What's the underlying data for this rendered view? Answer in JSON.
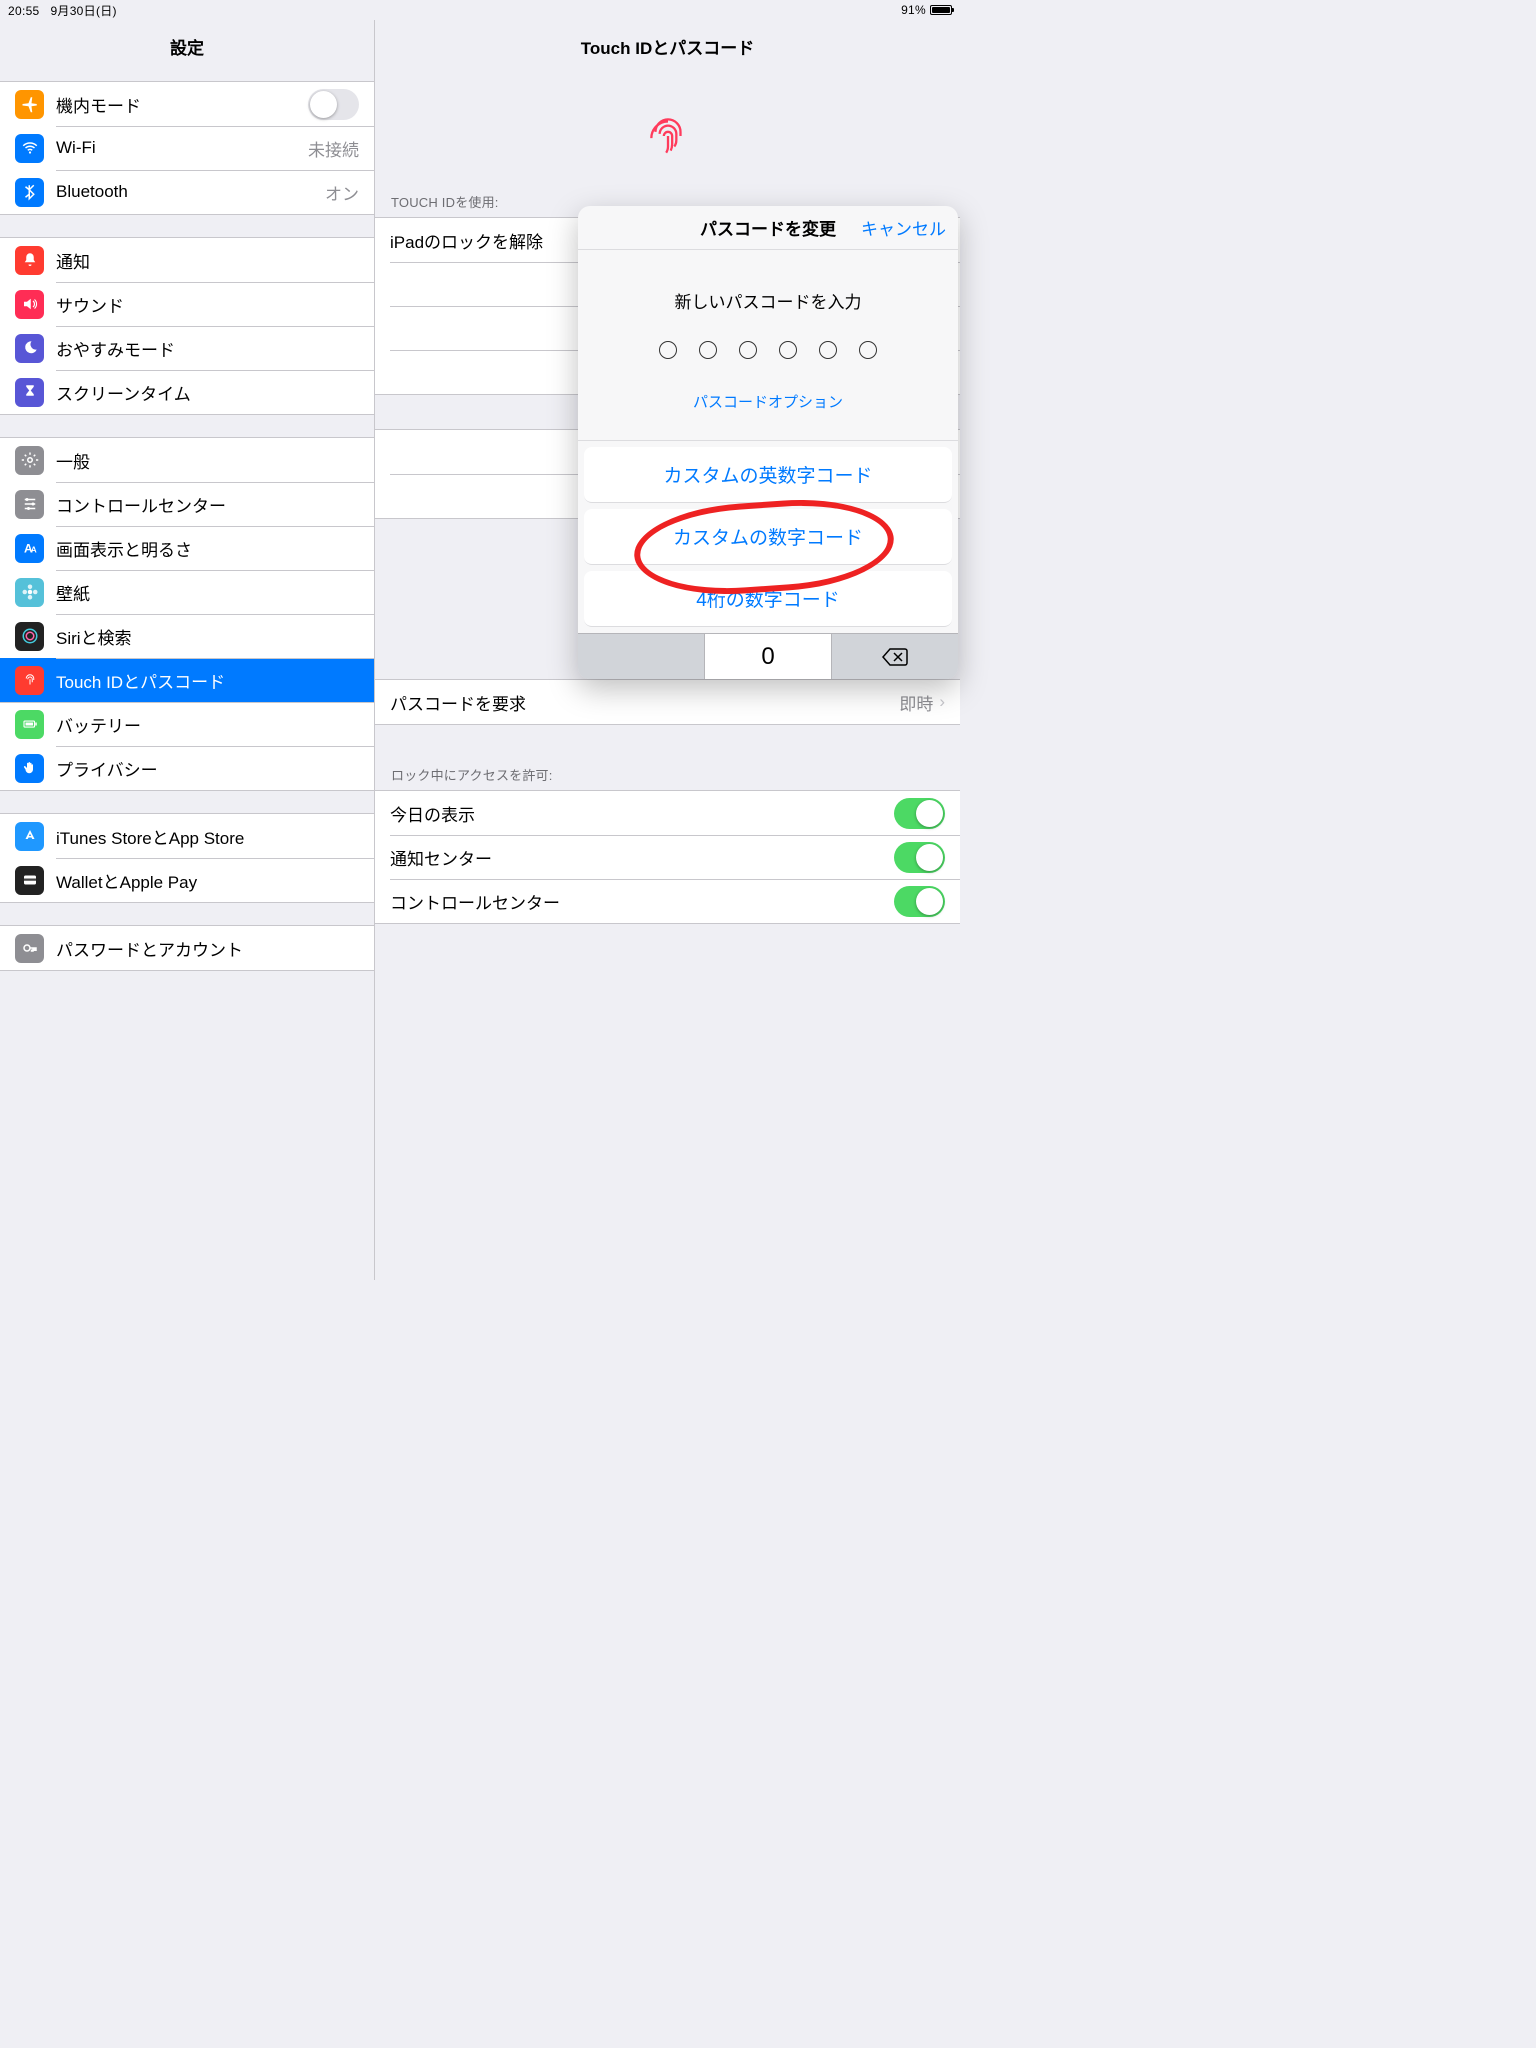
{
  "status": {
    "time": "20:55",
    "date": "9月30日(日)",
    "battery_pct": "91%"
  },
  "sidebar": {
    "title": "設定",
    "groups": [
      [
        {
          "id": "airplane",
          "label": "機内モード",
          "icon": "airplane",
          "bg": "#ff9500",
          "switch": false
        },
        {
          "id": "wifi",
          "label": "Wi-Fi",
          "icon": "wifi",
          "bg": "#007aff",
          "detail": "未接続"
        },
        {
          "id": "bluetooth",
          "label": "Bluetooth",
          "icon": "bluetooth",
          "bg": "#007aff",
          "detail": "オン"
        }
      ],
      [
        {
          "id": "notifications",
          "label": "通知",
          "icon": "bell",
          "bg": "#ff3b30"
        },
        {
          "id": "sounds",
          "label": "サウンド",
          "icon": "speaker",
          "bg": "#ff2d55"
        },
        {
          "id": "dnd",
          "label": "おやすみモード",
          "icon": "moon",
          "bg": "#5856d6"
        },
        {
          "id": "screentime",
          "label": "スクリーンタイム",
          "icon": "hourglass",
          "bg": "#5856d6"
        }
      ],
      [
        {
          "id": "general",
          "label": "一般",
          "icon": "gear",
          "bg": "#8e8e93"
        },
        {
          "id": "controlcenter",
          "label": "コントロールセンター",
          "icon": "sliders",
          "bg": "#8e8e93"
        },
        {
          "id": "display",
          "label": "画面表示と明るさ",
          "icon": "text",
          "bg": "#007aff"
        },
        {
          "id": "wallpaper",
          "label": "壁紙",
          "icon": "flower",
          "bg": "#55c1d9"
        },
        {
          "id": "siri",
          "label": "Siriと検索",
          "icon": "siri",
          "bg": "#222"
        },
        {
          "id": "touchid",
          "label": "Touch IDとパスコード",
          "icon": "fingerprint",
          "bg": "#ff3b30",
          "selected": true
        },
        {
          "id": "battery",
          "label": "バッテリー",
          "icon": "battery",
          "bg": "#4cd964"
        },
        {
          "id": "privacy",
          "label": "プライバシー",
          "icon": "hand",
          "bg": "#007aff"
        }
      ],
      [
        {
          "id": "itunes",
          "label": "iTunes StoreとApp Store",
          "icon": "appstore",
          "bg": "#1f98ff"
        },
        {
          "id": "wallet",
          "label": "WalletとApple Pay",
          "icon": "wallet",
          "bg": "#222"
        }
      ],
      [
        {
          "id": "passwords",
          "label": "パスワードとアカウント",
          "icon": "key",
          "bg": "#8e8e93"
        }
      ]
    ]
  },
  "detail": {
    "title": "Touch IDとパスコード",
    "touchid_header": "TOUCH IDを使用:",
    "touchid_rows": [
      {
        "label": "iPadのロックを解除",
        "on": true
      },
      {
        "label": "",
        "on": false
      },
      {
        "label": "",
        "on": false
      },
      {
        "label": "",
        "on": true
      }
    ],
    "mid_rows": [
      {
        "label": "",
        "chevron": true
      },
      {
        "label": "",
        "chevron": true
      }
    ],
    "require": {
      "label": "パスコードを要求",
      "value": "即時"
    },
    "lock_header": "ロック中にアクセスを許可:",
    "lock_rows": [
      {
        "label": "今日の表示",
        "on": true
      },
      {
        "label": "通知センター",
        "on": true
      },
      {
        "label": "コントロールセンター",
        "on": true
      }
    ]
  },
  "sheet": {
    "title": "パスコードを変更",
    "cancel": "キャンセル",
    "prompt": "新しいパスコードを入力",
    "options_link": "パスコードオプション",
    "options": [
      "カスタムの英数字コード",
      "カスタムの数字コード",
      "4桁の数字コード"
    ],
    "key_zero": "0"
  }
}
